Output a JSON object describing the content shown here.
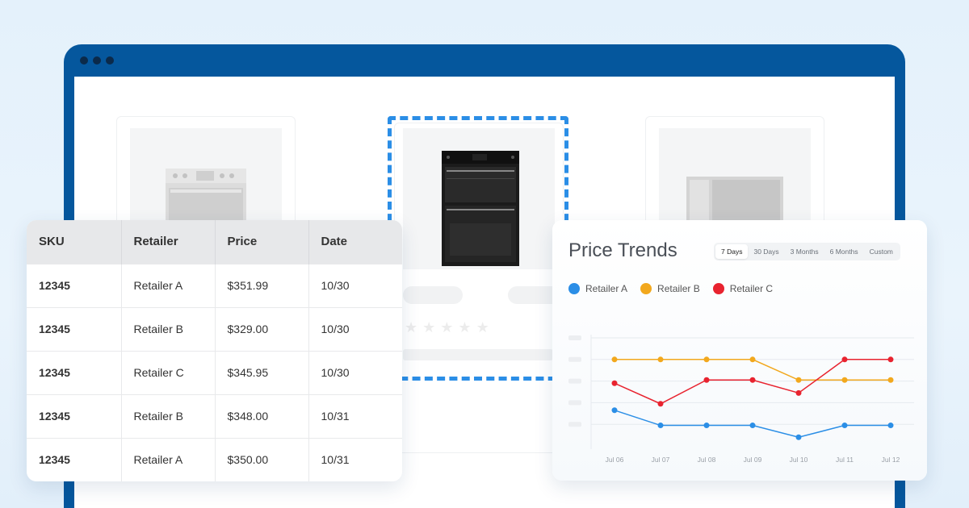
{
  "table": {
    "columns": [
      "SKU",
      "Retailer",
      "Price",
      "Date"
    ],
    "rows": [
      {
        "sku": "12345",
        "retailer": "Retailer A",
        "price": "$351.99",
        "date": "10/30"
      },
      {
        "sku": "12345",
        "retailer": "Retailer B",
        "price": "$329.00",
        "date": "10/30"
      },
      {
        "sku": "12345",
        "retailer": "Retailer C",
        "price": "$345.95",
        "date": "10/30"
      },
      {
        "sku": "12345",
        "retailer": "Retailer B",
        "price": "$348.00",
        "date": "10/31"
      },
      {
        "sku": "12345",
        "retailer": "Retailer A",
        "price": "$350.00",
        "date": "10/31"
      }
    ]
  },
  "trends": {
    "title": "Price Trends",
    "ranges": [
      "7 Days",
      "30 Days",
      "3 Months",
      "6 Months",
      "Custom"
    ],
    "active_range": "7 Days"
  },
  "chart_data": {
    "type": "line",
    "title": "Price Trends",
    "x": [
      "Jul 06",
      "Jul 07",
      "Jul 08",
      "Jul 09",
      "Jul 10",
      "Jul 11",
      "Jul 12"
    ],
    "ylim": [
      0,
      5
    ],
    "grid": true,
    "legend_position": "top-left",
    "series": [
      {
        "name": "Retailer A",
        "color": "#2b8ee6",
        "values": [
          1.65,
          0.95,
          0.95,
          0.95,
          0.4,
          0.95,
          0.95
        ]
      },
      {
        "name": "Retailer B",
        "color": "#f2a81d",
        "values": [
          4.0,
          4.0,
          4.0,
          4.0,
          3.05,
          3.05,
          3.05
        ]
      },
      {
        "name": "Retailer C",
        "color": "#e8232f",
        "values": [
          2.9,
          1.95,
          3.05,
          3.05,
          2.45,
          4.0,
          4.0
        ]
      }
    ]
  },
  "colors": {
    "frame": "#05579d",
    "selection": "#2b8ee6"
  },
  "icons": [
    "star-icon",
    "oven-icon"
  ]
}
